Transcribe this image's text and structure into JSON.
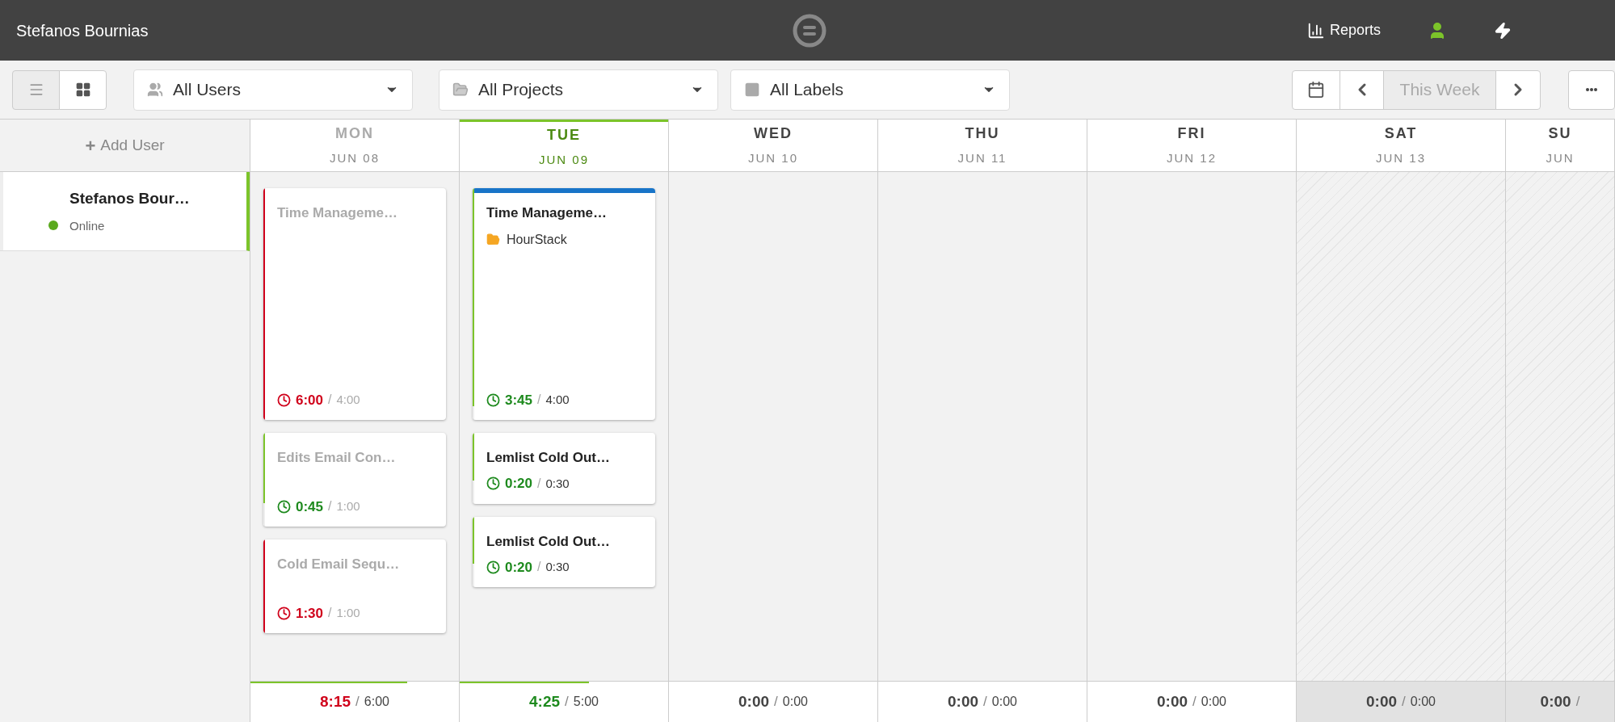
{
  "header": {
    "user_name": "Stefanos Bournias",
    "nav": [
      {
        "kind": "reports",
        "label": "Reports"
      },
      {
        "kind": "profile"
      },
      {
        "kind": "activity"
      }
    ]
  },
  "toolbar": {
    "views": [
      {
        "kind": "list",
        "selected": false
      },
      {
        "kind": "grid",
        "selected": true
      }
    ],
    "filters": [
      {
        "kind": "users",
        "label": "All Users"
      },
      {
        "kind": "projects",
        "label": "All Projects"
      },
      {
        "kind": "labels",
        "label": "All Labels"
      }
    ],
    "week_label": "This Week"
  },
  "add_user": {
    "icon": "+",
    "label": "Add User"
  },
  "users": [
    {
      "name": "Stefanos Bour…",
      "status": "Online",
      "online": true,
      "selected": true
    }
  ],
  "days": [
    {
      "day": "MON",
      "date": "JUN 08",
      "today": false,
      "past": true,
      "weekend": false,
      "total": {
        "actual": "8:15",
        "separator": "/",
        "planned": "6:00",
        "over": true,
        "level": 0.75
      },
      "tasks": [
        {
          "title": "Time Manageme…",
          "actual": "6:00",
          "separator": "/",
          "planned": "4:00",
          "over": true,
          "level": 1
        },
        {
          "title": "Edits Email Con…",
          "actual": "0:45",
          "separator": "/",
          "planned": "1:00",
          "over": false,
          "level": 0.75
        },
        {
          "title": "Cold Email Sequ…",
          "actual": "1:30",
          "separator": "/",
          "planned": "1:00",
          "over": true,
          "level": 1
        }
      ]
    },
    {
      "day": "TUE",
      "date": "JUN 09",
      "today": true,
      "past": false,
      "weekend": false,
      "total": {
        "actual": "4:25",
        "separator": "/",
        "planned": "5:00",
        "over": false,
        "level": 0.62
      },
      "tasks": [
        {
          "title": "Time Manageme…",
          "project": "HourStack",
          "color": "#1874c8",
          "actual": "3:45",
          "separator": "/",
          "planned": "4:00",
          "over": false,
          "level": 0.94
        },
        {
          "title": "Lemlist Cold Out…",
          "actual": "0:20",
          "separator": "/",
          "planned": "0:30",
          "over": false,
          "level": 0.67
        },
        {
          "title": "Lemlist Cold Out…",
          "actual": "0:20",
          "separator": "/",
          "planned": "0:30",
          "over": false,
          "level": 0.67
        }
      ]
    },
    {
      "day": "WED",
      "date": "JUN 10",
      "today": false,
      "past": false,
      "weekend": false,
      "total": {
        "actual": "0:00",
        "separator": "/",
        "planned": "0:00",
        "over": false
      }
    },
    {
      "day": "THU",
      "date": "JUN 11",
      "today": false,
      "past": false,
      "weekend": false,
      "total": {
        "actual": "0:00",
        "separator": "/",
        "planned": "0:00",
        "over": false
      }
    },
    {
      "day": "FRI",
      "date": "JUN 12",
      "today": false,
      "past": false,
      "weekend": false,
      "total": {
        "actual": "0:00",
        "separator": "/",
        "planned": "0:00",
        "over": false
      }
    },
    {
      "day": "SAT",
      "date": "JUN 13",
      "today": false,
      "past": false,
      "weekend": true,
      "total": {
        "actual": "0:00",
        "separator": "/",
        "planned": "0:00",
        "over": false
      }
    },
    {
      "day": "SU",
      "date": "JUN",
      "today": false,
      "past": false,
      "weekend": true,
      "total": {
        "actual": "0:00",
        "separator": "/",
        "over": false
      }
    }
  ]
}
